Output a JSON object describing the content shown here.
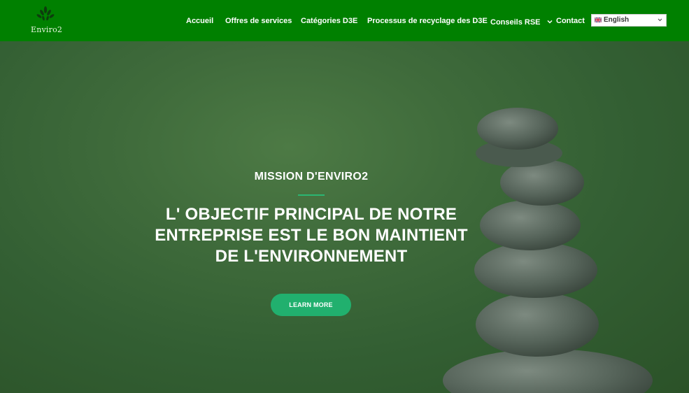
{
  "header": {
    "logo_text": "Enviro2",
    "nav": [
      {
        "label": "Accueil"
      },
      {
        "label": "Offres de services"
      },
      {
        "label": "Catégories D3E"
      },
      {
        "label": "Processus de recyclage des D3E"
      },
      {
        "label": "Conseils RSE",
        "has_dropdown": true
      },
      {
        "label": "Contact"
      }
    ],
    "language": {
      "selected": "English"
    }
  },
  "hero": {
    "subtitle": "MISSION D'ENVIRO2",
    "headline": [
      "L' OBJECTIF PRINCIPAL DE NOTRE",
      "ENTREPRISE EST LE BON MAINTIENT",
      "DE L'ENVIRONNEMENT"
    ],
    "cta_label": "LEARN MORE"
  },
  "colors": {
    "header_bg": "#008000",
    "accent": "#21b06e",
    "hero_bg": "#3f6b3b"
  }
}
